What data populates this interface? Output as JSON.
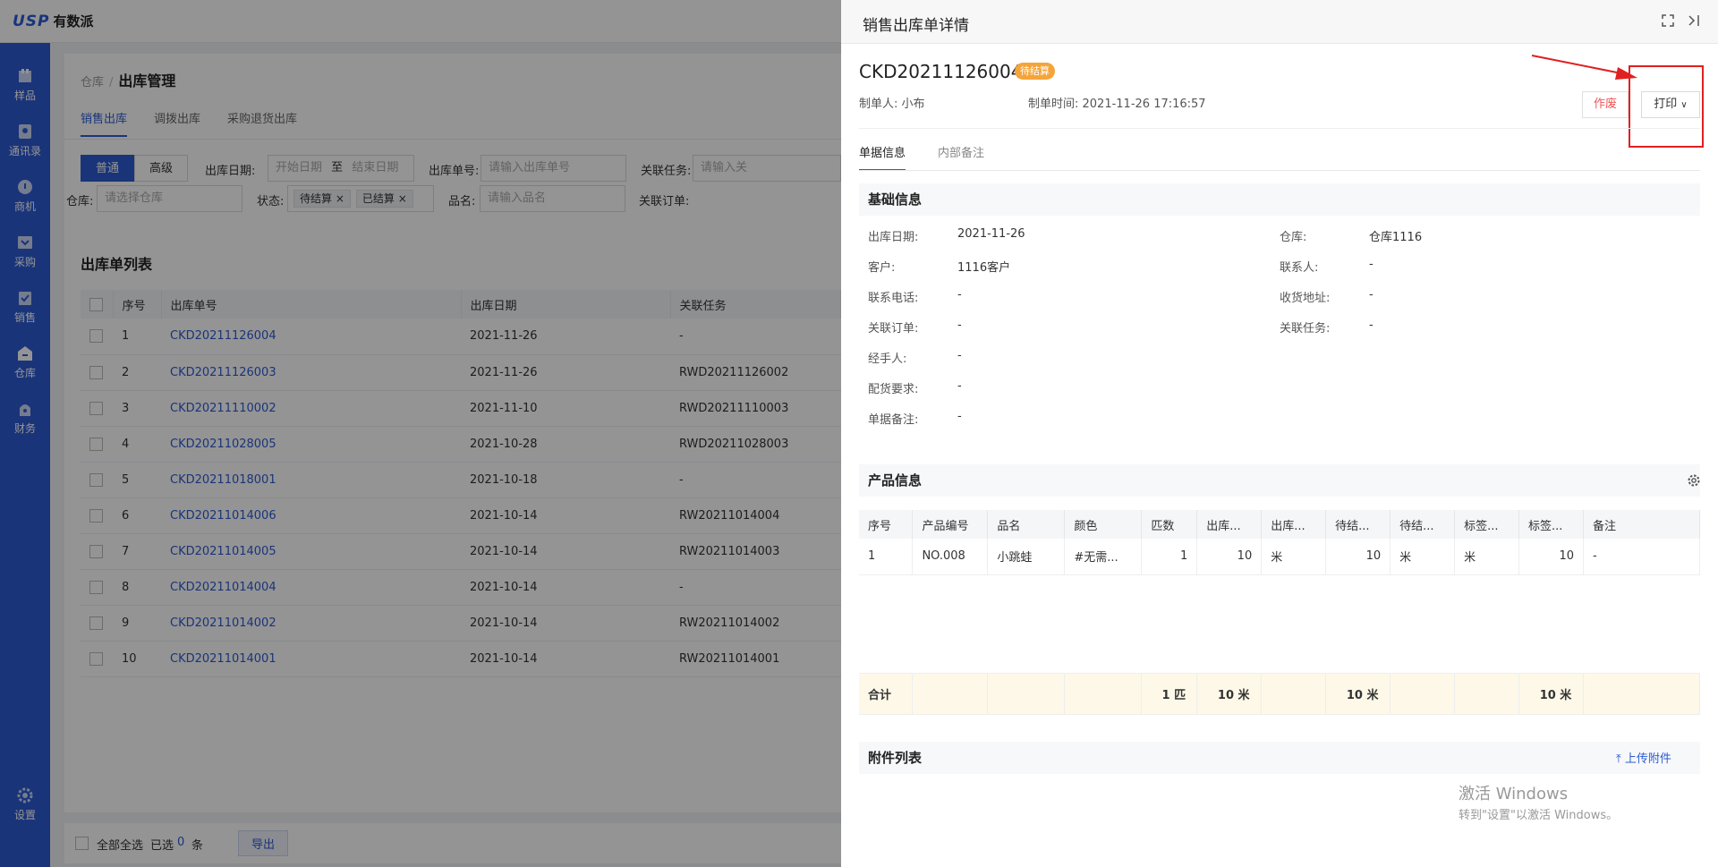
{
  "app": {
    "logo_mark": "USP",
    "logo_text": "有数派"
  },
  "nav": [
    {
      "label": "样品",
      "icon": "sample-icon"
    },
    {
      "label": "通讯录",
      "icon": "contacts-icon"
    },
    {
      "label": "商机",
      "icon": "opportunity-icon"
    },
    {
      "label": "采购",
      "icon": "purchase-icon"
    },
    {
      "label": "销售",
      "icon": "sales-icon"
    },
    {
      "label": "仓库",
      "icon": "warehouse-icon"
    },
    {
      "label": "财务",
      "icon": "finance-icon"
    },
    {
      "label": "设置",
      "icon": "settings-icon"
    }
  ],
  "breadcrumb": {
    "parent": "仓库",
    "sep": "/",
    "current": "出库管理"
  },
  "tabs": [
    "销售出库",
    "调拨出库",
    "采购退货出库"
  ],
  "filters": {
    "mode_normal": "普通",
    "mode_advanced": "高级",
    "date_label": "出库日期:",
    "date_start": "开始日期",
    "date_to": "至",
    "date_end": "结束日期",
    "no_label": "出库单号:",
    "no_placeholder": "请输入出库单号",
    "task_label": "关联任务:",
    "task_placeholder": "请输入关",
    "wh_label": "仓库:",
    "wh_placeholder": "请选择仓库",
    "status_label": "状态:",
    "status_tag1": "待结算",
    "status_tag2": "已结算",
    "name_label": "品名:",
    "name_placeholder": "请输入品名",
    "order_label": "关联订单:"
  },
  "list": {
    "title": "出库单列表",
    "headers": [
      "序号",
      "出库单号",
      "出库日期",
      "关联任务"
    ],
    "rows": [
      [
        "1",
        "CKD20211126004",
        "2021-11-26",
        "-"
      ],
      [
        "2",
        "CKD20211126003",
        "2021-11-26",
        "RWD20211126002"
      ],
      [
        "3",
        "CKD20211110002",
        "2021-11-10",
        "RWD20211110003"
      ],
      [
        "4",
        "CKD20211028005",
        "2021-10-28",
        "RWD20211028003"
      ],
      [
        "5",
        "CKD20211018001",
        "2021-10-18",
        "-"
      ],
      [
        "6",
        "CKD20211014006",
        "2021-10-14",
        "RW20211014004"
      ],
      [
        "7",
        "CKD20211014005",
        "2021-10-14",
        "RW20211014003"
      ],
      [
        "8",
        "CKD20211014004",
        "2021-10-14",
        "-"
      ],
      [
        "9",
        "CKD20211014002",
        "2021-10-14",
        "RW20211014002"
      ],
      [
        "10",
        "CKD20211014001",
        "2021-10-14",
        "RW20211014001"
      ]
    ]
  },
  "bottom": {
    "select_all": "全部全选",
    "selected": "已选",
    "count": "0",
    "unit": "条",
    "export": "导出"
  },
  "drawer": {
    "title": "销售出库单详情",
    "doc_no": "CKD20211126004",
    "status": "待结算",
    "creator": "制单人: 小布",
    "created_at": "制单时间: 2021-11-26 17:16:57",
    "void_btn": "作废",
    "print_btn": "打印",
    "tabs": [
      "单据信息",
      "内部备注"
    ],
    "basic_title": "基础信息",
    "basic_left": [
      {
        "k": "出库日期:",
        "v": "2021-11-26"
      },
      {
        "k": "客户:",
        "v": "1116客户"
      },
      {
        "k": "联系电话:",
        "v": "-"
      },
      {
        "k": "关联订单:",
        "v": "-"
      },
      {
        "k": "经手人:",
        "v": "-"
      },
      {
        "k": "配货要求:",
        "v": "-"
      },
      {
        "k": "单据备注:",
        "v": "-"
      }
    ],
    "basic_right": [
      {
        "k": "仓库:",
        "v": "仓库1116"
      },
      {
        "k": "联系人:",
        "v": "-"
      },
      {
        "k": "收货地址:",
        "v": "-"
      },
      {
        "k": "关联任务:",
        "v": "-"
      }
    ],
    "product_title": "产品信息",
    "product_headers": [
      "序号",
      "产品编号",
      "品名",
      "颜色",
      "匹数",
      "出库...",
      "出库...",
      "待结...",
      "待结...",
      "标签...",
      "标签...",
      "备注"
    ],
    "product_row": [
      "1",
      "NO.008",
      "小跳蛙",
      "#无需...",
      "1",
      "10",
      "米",
      "10",
      "米",
      "米",
      "10",
      "-"
    ],
    "sum_row": [
      "合计",
      "",
      "",
      "",
      "1 匹",
      "10 米",
      "",
      "10 米",
      "",
      "",
      "10 米",
      ""
    ],
    "attach_title": "附件列表",
    "upload": "上传附件"
  },
  "watermark": {
    "line1": "激活 Windows",
    "line2": "转到\"设置\"以激活 Windows。"
  }
}
